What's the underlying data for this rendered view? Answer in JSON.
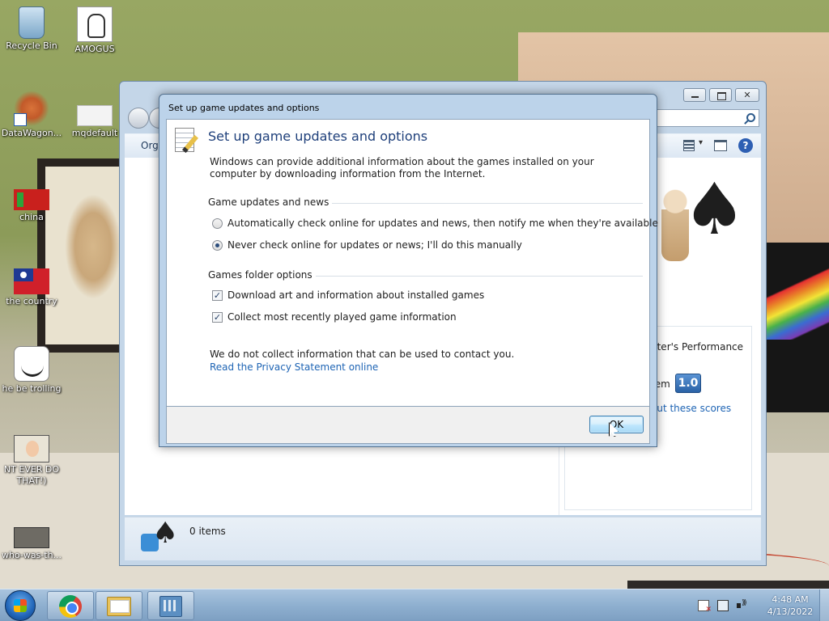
{
  "desktop": {
    "icons": [
      {
        "label": "Recycle Bin"
      },
      {
        "label": "AMOGUS"
      },
      {
        "label": "DataWagon..."
      },
      {
        "label": "mqdefault"
      },
      {
        "label": "china"
      },
      {
        "label": "the country"
      },
      {
        "label": "he be trolling"
      },
      {
        "label": "NT EVER DO THAT!)"
      },
      {
        "label": "who-was-th..."
      }
    ]
  },
  "explorer": {
    "command_bar": {
      "organize_label": "Orga"
    },
    "performance": {
      "title_fragment": "uter's Performance",
      "system_fragment": "tem",
      "score": "1.0",
      "link_fragment": "out these scores"
    },
    "status": {
      "items_text": "0 items"
    }
  },
  "dialog": {
    "title": "Set up game updates and options",
    "heading": "Set up game updates and options",
    "description": "Windows can provide additional information about the games installed on your computer by downloading information from the Internet.",
    "group_updates": {
      "label": "Game updates and news",
      "options": [
        {
          "label": "Automatically check online for updates and news, then notify me when they're available",
          "selected": false
        },
        {
          "label": "Never check online for updates or news; I'll do this manually",
          "selected": true
        }
      ]
    },
    "group_folder": {
      "label": "Games folder options",
      "options": [
        {
          "label": "Download art and information about installed games",
          "checked": true
        },
        {
          "label": "Collect most recently played game information",
          "checked": true
        }
      ]
    },
    "privacy_note": "We do not collect information that can be used to contact you.",
    "privacy_link": "Read the Privacy Statement online",
    "ok_label": "OK"
  },
  "taskbar": {
    "clock_time": "4:48 AM",
    "clock_date": "4/13/2022"
  }
}
